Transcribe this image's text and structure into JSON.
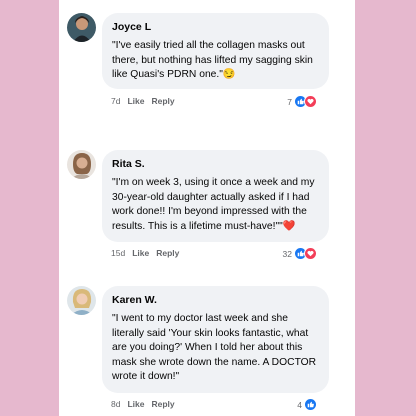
{
  "comments": [
    {
      "name": "Joyce L",
      "text": "\"I've easily tried all the collagen masks out there, but nothing has lifted my sagging skin like Quasi's PDRN one.\"",
      "emoji": "😏",
      "time": "7d",
      "like_label": "Like",
      "reply_label": "Reply",
      "reaction_count": "7",
      "reactions": [
        "like-icon",
        "love-icon"
      ]
    },
    {
      "name": "Rita S.",
      "text": "\"I'm on week 3, using it once a week and my 30-year-old daughter actually asked if I had work done!! I'm beyond impressed with the results. This is a lifetime must-have!\"\"",
      "emoji": "❤️",
      "time": "15d",
      "like_label": "Like",
      "reply_label": "Reply",
      "reaction_count": "32",
      "reactions": [
        "like-icon",
        "love-icon"
      ]
    },
    {
      "name": "Karen W.",
      "text": "\"I went to my doctor last week and she literally said 'Your skin looks fantastic, what are you doing?' When I told her about this mask she wrote down the name. A DOCTOR wrote it down!\"",
      "emoji": "",
      "time": "8d",
      "like_label": "Like",
      "reply_label": "Reply",
      "reaction_count": "4",
      "reactions": [
        "like-icon"
      ]
    }
  ],
  "colors": {
    "background": "#e6b8ce",
    "bubble": "#f0f2f5",
    "like": "#1877f2",
    "love": "#f33e58",
    "meta_text": "#65676b"
  }
}
